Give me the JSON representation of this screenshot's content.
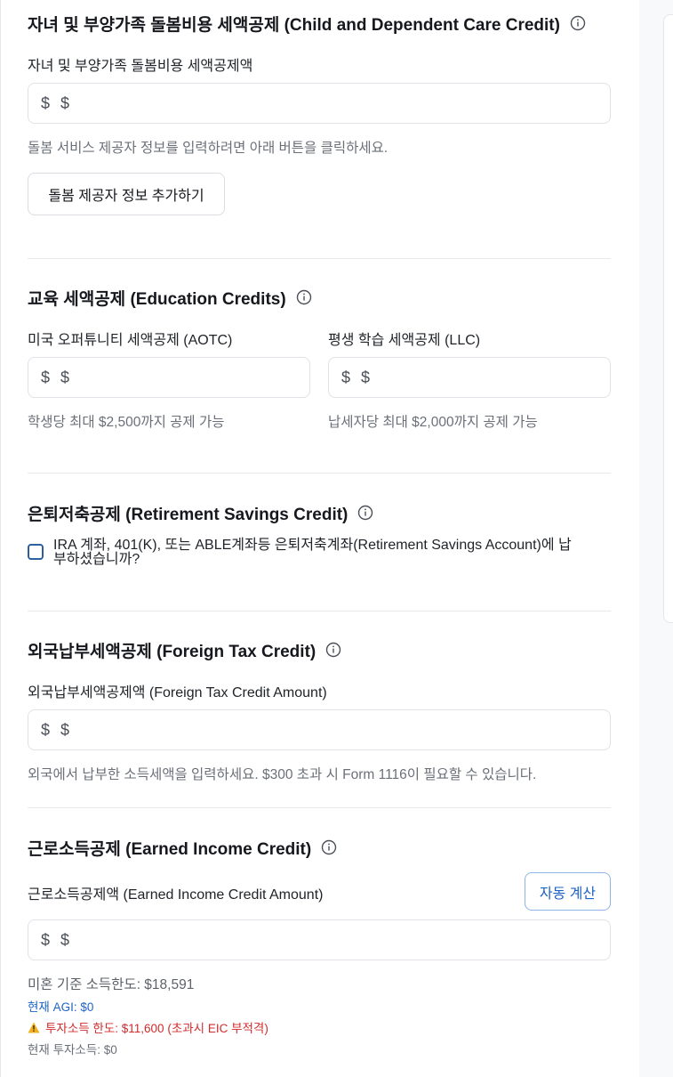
{
  "dependent_care": {
    "title": "자녀 및 부양가족 돌봄비용 세액공제 (Child and Dependent Care Credit)",
    "amount_label": "자녀 및 부양가족 돌봄비용 세액공제액",
    "currency": "$",
    "amount_placeholder": "$",
    "help": "돌봄 서비스 제공자 정보를 입력하려면 아래 버튼을 클릭하세요.",
    "add_provider_button": "돌봄 제공자 정보 추가하기"
  },
  "education": {
    "title": "교육 세액공제 (Education Credits)",
    "aotc_label": "미국 오퍼튜니티 세액공제 (AOTC)",
    "aotc_currency": "$",
    "aotc_placeholder": "$",
    "aotc_help": "학생당 최대 $2,500까지 공제 가능",
    "llc_label": "평생 학습 세액공제 (LLC)",
    "llc_currency": "$",
    "llc_placeholder": "$",
    "llc_help": "납세자당 최대 $2,000까지 공제 가능"
  },
  "retirement": {
    "title": "은퇴저축공제 (Retirement Savings Credit)",
    "checkbox_line1": "IRA 계좌, 401(K), 또는 ABLE계좌등 은퇴저축계좌(Retirement Savings Account)에 납",
    "checkbox_line2": "부하셨습니까?",
    "checked": false
  },
  "foreign_tax": {
    "title": "외국납부세액공제 (Foreign Tax Credit)",
    "amount_label": "외국납부세액공제액 (Foreign Tax Credit Amount)",
    "currency": "$",
    "amount_placeholder": "$",
    "help": "외국에서 납부한 소득세액을 입력하세요. $300 초과 시 Form 1116이 필요할 수 있습니다."
  },
  "eic": {
    "title": "근로소득공제 (Earned Income Credit)",
    "amount_label": "근로소득공제액 (Earned Income Credit Amount)",
    "auto_calc_button": "자동 계산",
    "currency": "$",
    "amount_placeholder": "$",
    "income_limit": "미혼 기준 소득한도: $18,591",
    "current_agi": "현재 AGI: $0",
    "investment_limit": "투자소득 한도: $11,600 (초과시 EIC 부적격)",
    "current_investment": "현재 투자소득: $0"
  },
  "colors": {
    "accent_blue": "#1e63c4",
    "warning_red": "#d02c2c",
    "warning_yellow": "#f2b01e",
    "checkbox_border": "#2b5f9e"
  },
  "icons": [
    "info-icon",
    "warning-icon"
  ]
}
